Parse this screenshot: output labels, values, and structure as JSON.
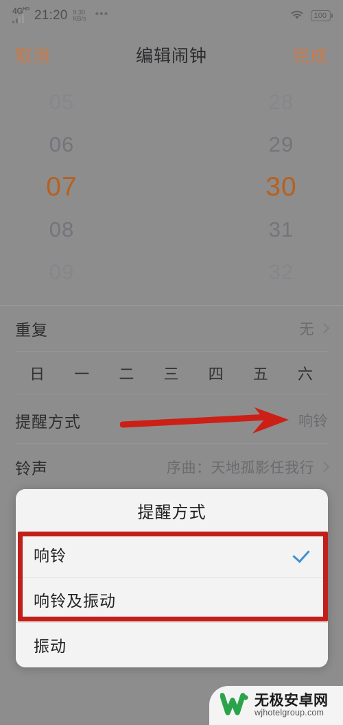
{
  "status_bar": {
    "network_type": "4G",
    "network_type_sup": "HD",
    "time": "21:20",
    "speed_value": "9.30",
    "speed_unit": "KB/s",
    "overflow_icon": "•••",
    "wifi_icon": "wifi-icon",
    "battery_level": "100"
  },
  "nav": {
    "cancel_label": "取消",
    "title": "编辑闹钟",
    "done_label": "完成"
  },
  "time_picker": {
    "hours": [
      "05",
      "06",
      "07",
      "08",
      "09"
    ],
    "minutes": [
      "28",
      "29",
      "30",
      "31",
      "32"
    ],
    "selected_hour": "07",
    "selected_minute": "30",
    "selected_color": "#b8601f"
  },
  "settings": {
    "repeat": {
      "label": "重复",
      "value": "无",
      "chevron_icon": "chevron-right-icon"
    },
    "weekdays": [
      "日",
      "一",
      "二",
      "三",
      "四",
      "五",
      "六"
    ],
    "reminder_method": {
      "label": "提醒方式",
      "value": "响铃"
    },
    "ringtone": {
      "label": "铃声",
      "value": "序曲：天地孤影任我行",
      "chevron_icon": "chevron-right-icon"
    }
  },
  "dialog": {
    "title": "提醒方式",
    "options": [
      {
        "label": "响铃",
        "checked": true
      },
      {
        "label": "响铃及振动",
        "checked": false
      },
      {
        "label": "振动",
        "checked": false
      }
    ],
    "check_icon": "check-icon",
    "check_color": "#3f8fd0"
  },
  "annotations": {
    "arrow_color": "#cc1f15",
    "box_color": "#c1201a",
    "arrow_icon": "arrow-right-icon"
  },
  "watermark": {
    "logo_icon": "w-logo-icon",
    "site_name": "无极安卓网",
    "site_url": "wjhotelgroup.com",
    "logo_color": "#2aa34a"
  }
}
